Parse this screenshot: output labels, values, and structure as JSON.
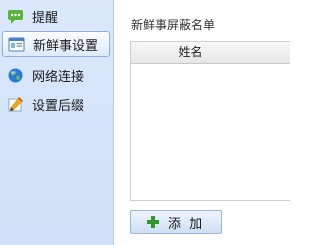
{
  "sidebar": {
    "items": [
      {
        "label": "提醒",
        "icon": "speech-bubble-icon",
        "color": "#5bb53a"
      },
      {
        "label": "新鲜事设置",
        "icon": "card-icon",
        "color": "#4a7fc1",
        "selected": true
      },
      {
        "label": "网络连接",
        "icon": "globe-icon",
        "color": "#2a7ad6"
      },
      {
        "label": "设置后缀",
        "icon": "pencil-icon",
        "color": "#e5a91d"
      }
    ]
  },
  "main": {
    "section_title": "新鲜事屏蔽名单",
    "list": {
      "column_header": "姓名",
      "rows": []
    },
    "add_button_label": "添 加",
    "add_button_icon": "plus-icon"
  }
}
